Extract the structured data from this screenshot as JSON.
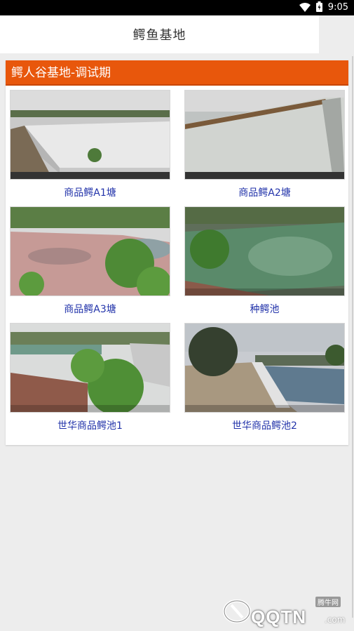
{
  "status_bar": {
    "time": "9:05",
    "icons": [
      "wifi-icon",
      "battery-icon"
    ]
  },
  "app_bar": {
    "title": "鳄鱼基地"
  },
  "section": {
    "title": "鳄人谷基地-调试期",
    "accent_color": "#e8570c",
    "cameras": [
      {
        "label": "商品鳄A1塘"
      },
      {
        "label": "商品鳄A2塘"
      },
      {
        "label": "商品鳄A3塘"
      },
      {
        "label": "种鳄池"
      },
      {
        "label": "世华商品鳄池1"
      },
      {
        "label": "世华商品鳄池2"
      }
    ]
  },
  "watermark": {
    "brand": "QQTN",
    "domain": ".com",
    "sub": "腾牛网"
  }
}
